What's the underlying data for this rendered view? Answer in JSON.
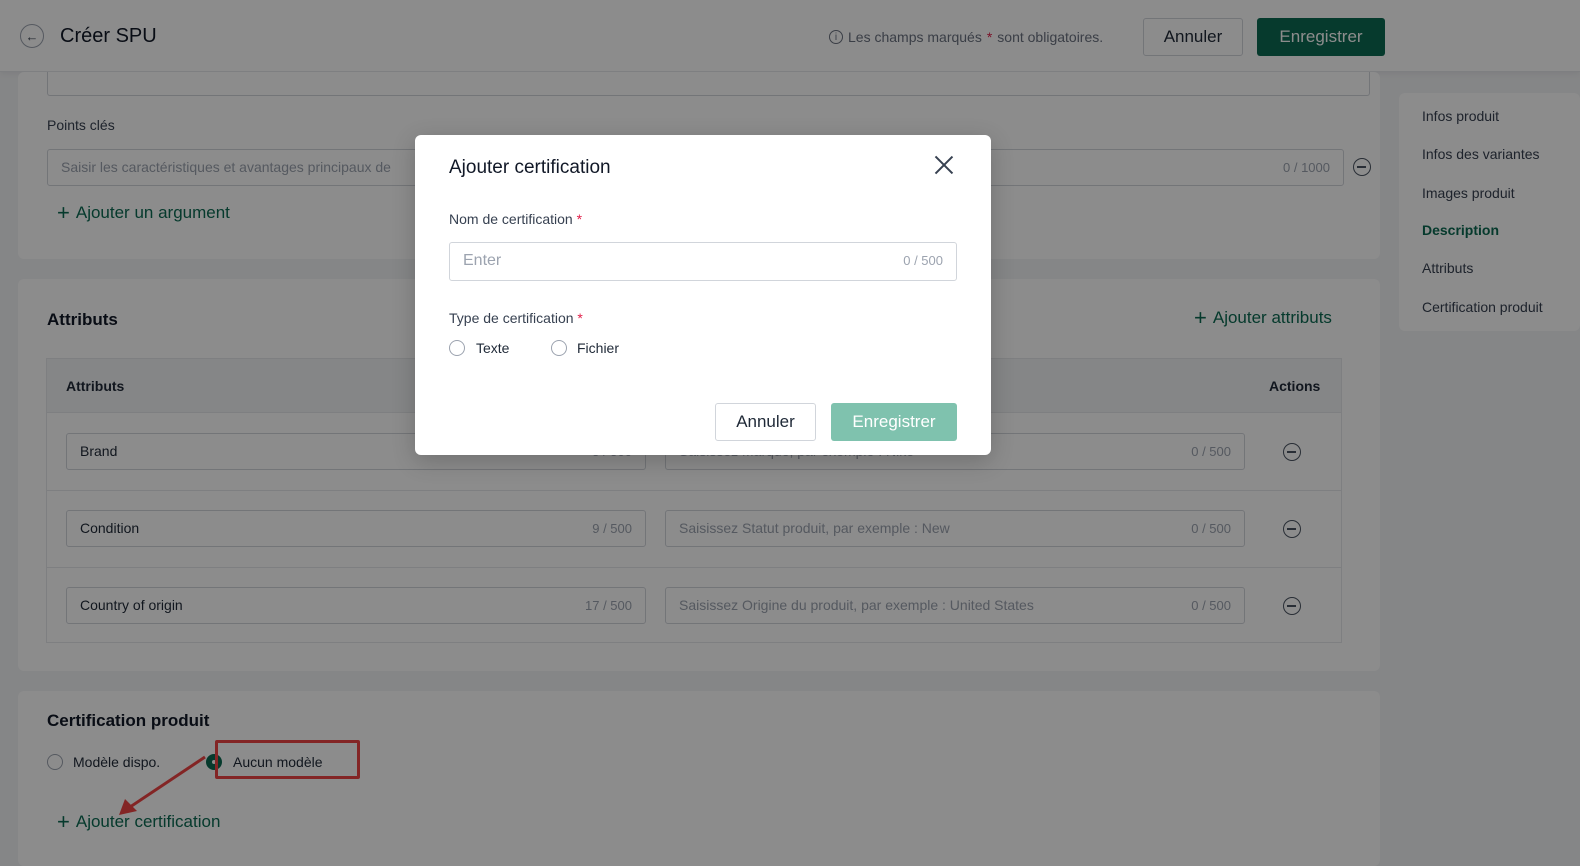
{
  "header": {
    "title": "Créer SPU",
    "required_note_before": "Les champs marqués",
    "required_star": "*",
    "required_note_after": "sont obligatoires.",
    "cancel_label": "Annuler",
    "save_label": "Enregistrer"
  },
  "right_nav": {
    "items": [
      {
        "label": "Infos produit"
      },
      {
        "label": "Infos des variantes"
      },
      {
        "label": "Images produit"
      },
      {
        "label": "Description"
      },
      {
        "label": "Attributs"
      },
      {
        "label": "Certification produit"
      }
    ],
    "active_index": 3
  },
  "description": {
    "key_points_label": "Points clés",
    "key_point_placeholder": "Saisir les caractéristiques et avantages principaux de",
    "key_point_count": "0 / 1000",
    "add_argument_label": "Ajouter un argument"
  },
  "attributes": {
    "title": "Attributs",
    "add_label": "Ajouter attributs",
    "columns": {
      "name": "Attributs",
      "actions": "Actions"
    },
    "rows": [
      {
        "name": "Brand",
        "name_count": "5 / 500",
        "value_placeholder": "Saisissez Marque, par exemple : Nike",
        "value_count": "0 / 500"
      },
      {
        "name": "Condition",
        "name_count": "9 / 500",
        "value_placeholder": "Saisissez Statut produit, par exemple : New",
        "value_count": "0 / 500"
      },
      {
        "name": "Country of origin",
        "name_count": "17 / 500",
        "value_placeholder": "Saisissez Origine du produit, par exemple : United States",
        "value_count": "0 / 500"
      }
    ]
  },
  "certification": {
    "title": "Certification produit",
    "option_template": "Modèle dispo.",
    "option_none": "Aucun modèle",
    "selected": "Aucun modèle",
    "add_label": "Ajouter certification"
  },
  "modal": {
    "title": "Ajouter certification",
    "name_label": "Nom de certification",
    "star": "*",
    "name_placeholder": "Enter",
    "name_count": "0 / 500",
    "type_label": "Type de certification",
    "type_options": [
      "Texte",
      "Fichier"
    ],
    "cancel_label": "Annuler",
    "save_label": "Enregistrer"
  }
}
